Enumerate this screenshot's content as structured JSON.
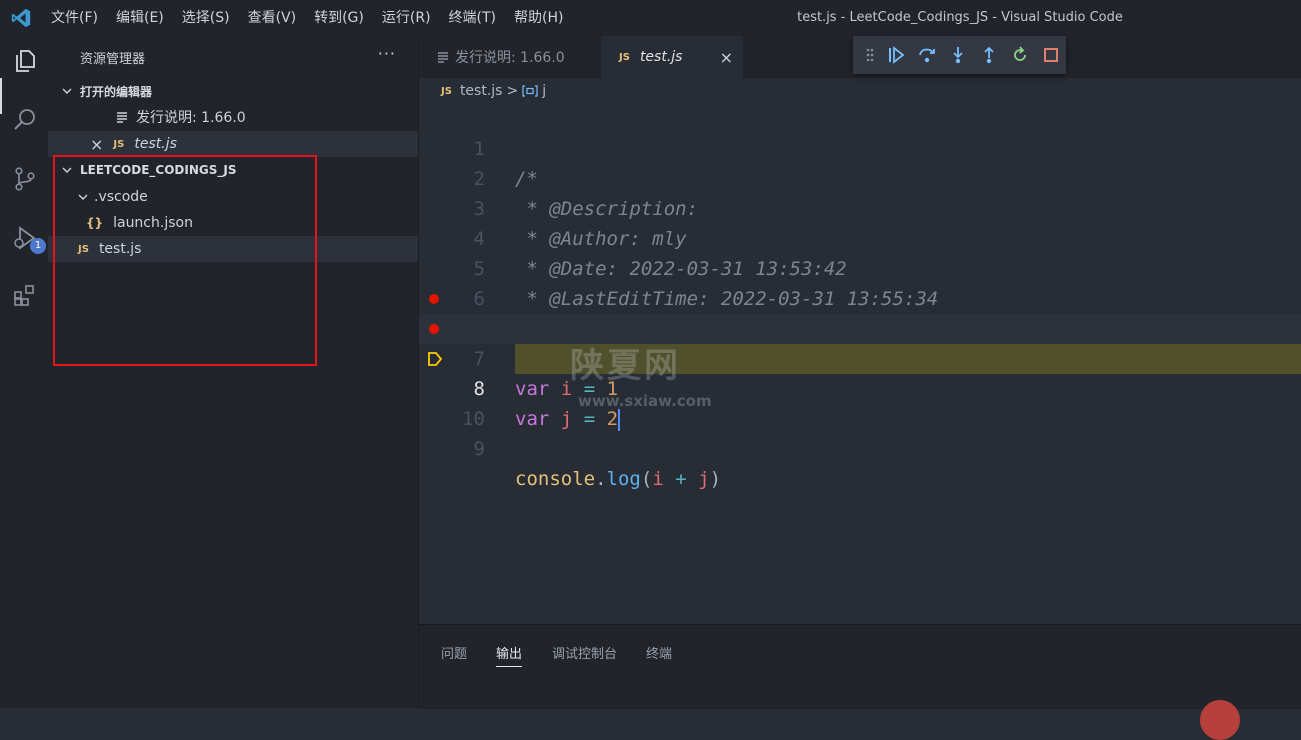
{
  "menu": [
    "文件(F)",
    "编辑(E)",
    "选择(S)",
    "查看(V)",
    "转到(G)",
    "运行(R)",
    "终端(T)",
    "帮助(H)"
  ],
  "window_title": "test.js - LeetCode_Codings_JS - Visual Studio Code",
  "activity": {
    "debug_badge": "1"
  },
  "sidebar": {
    "title": "资源管理器",
    "more": "···",
    "open_editors_header": "打开的编辑器",
    "open_editors": [
      {
        "label": "发行说明: 1.66.0"
      },
      {
        "label": "test.js",
        "close": "×",
        "badge": "JS"
      }
    ],
    "workspace_header": "LEETCODE_CODINGS_JS",
    "tree": {
      "vscode_folder": ".vscode",
      "launch_json": "launch.json",
      "launch_badge": "{}",
      "test_js": "test.js",
      "test_badge": "JS"
    }
  },
  "tabs": [
    {
      "label": "发行说明: 1.66.0"
    },
    {
      "label": "test.js",
      "badge": "JS",
      "close": "×"
    }
  ],
  "breadcrumb": {
    "badge": "JS",
    "file": "test.js",
    "separator": ">",
    "symbol": "j"
  },
  "editor": {
    "line_numbers": [
      "1",
      "2",
      "3",
      "4",
      "5",
      "6",
      "7",
      "8",
      "9",
      "10"
    ],
    "comment": {
      "l1": "/*",
      "l2": " * @Description:",
      "l3": " * @Author: mly",
      "l4": " * @Date: 2022-03-31 13:53:42",
      "l5": " * @LastEditTime: 2022-03-31 13:55:34",
      "l6": " */"
    },
    "l7": {
      "kw": "var",
      "name": "i",
      "op": "=",
      "num": "1"
    },
    "l8": {
      "kw": "var",
      "name": "j",
      "op": "=",
      "num": "2"
    },
    "l9": {
      "obj": "console",
      "dot": ".",
      "fn": "log",
      "open": "(",
      "a": "i",
      "op": "+",
      "b": "j",
      "close": ")"
    }
  },
  "watermark": {
    "big": "陕夏网",
    "small": "www.sxiaw.com"
  },
  "panel": {
    "tabs": [
      "问题",
      "输出",
      "调试控制台",
      "终端"
    ],
    "active_tab": "输出"
  },
  "colors": {
    "accent": "#4d78cc",
    "breakpoint": "#e51400",
    "highlight_box": "#e5141a",
    "debug_line": "#50512c"
  }
}
